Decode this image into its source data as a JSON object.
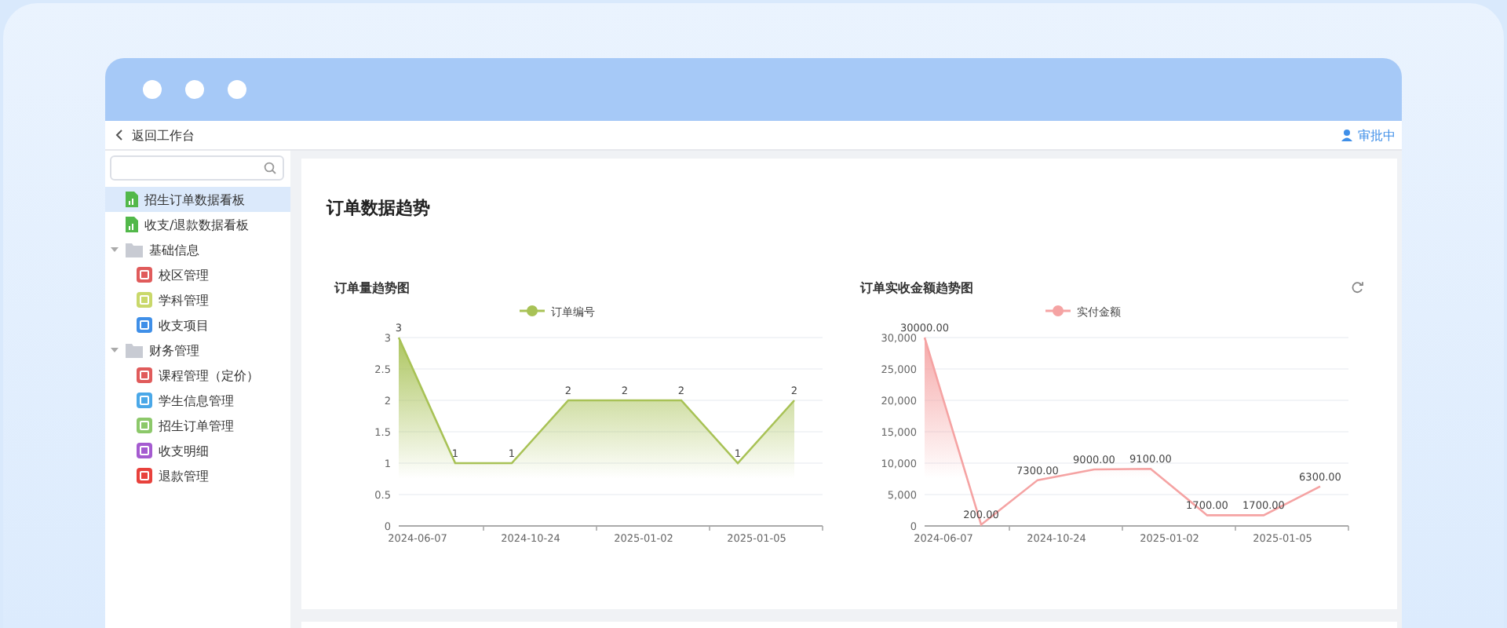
{
  "topbar": {
    "back_link": "返回工作台",
    "user_link": "审批中"
  },
  "sidebar": {
    "items": [
      {
        "kind": "page",
        "label": "招生订单数据看板",
        "selected": true
      },
      {
        "kind": "page",
        "label": "收支/退款数据看板",
        "selected": false
      },
      {
        "kind": "folder",
        "label": "基础信息",
        "selected": false,
        "expanded": true,
        "children": [
          {
            "label": "校区管理",
            "color": "#e05b5b",
            "selected": false
          },
          {
            "label": "学科管理",
            "color": "#c9d86a",
            "selected": false
          },
          {
            "label": "收支项目",
            "color": "#3f8fe8",
            "selected": false
          }
        ]
      },
      {
        "kind": "folder",
        "label": "财务管理",
        "selected": false,
        "expanded": true,
        "children": [
          {
            "label": "课程管理（定价）",
            "color": "#e05b5b",
            "selected": false
          },
          {
            "label": "学生信息管理",
            "color": "#4aa8e8",
            "selected": false
          },
          {
            "label": "招生订单管理",
            "color": "#8cc86a",
            "selected": false
          },
          {
            "label": "收支明细",
            "color": "#a55bd0",
            "selected": false
          },
          {
            "label": "退款管理",
            "color": "#e8413c",
            "selected": false
          }
        ]
      }
    ]
  },
  "main": {
    "title": "订单数据趋势",
    "charts": [
      {
        "refresh_button": false,
        "chart_data": {
          "type": "area",
          "grid": true,
          "title": "订单量趋势图",
          "categories": [
            "2024-06-07",
            null,
            "2024-10-24",
            null,
            "2025-01-02",
            null,
            "2025-01-05",
            null
          ],
          "ylim": [
            0,
            3
          ],
          "yticks": [
            0,
            0.5,
            1,
            1.5,
            2,
            2.5,
            3
          ],
          "series": [
            {
              "name": "订单编号",
              "color": "#a8c256",
              "values": [
                3,
                1,
                1,
                2,
                2,
                2,
                1,
                2
              ]
            }
          ],
          "value_labels": [
            "3",
            "1",
            "1",
            "2",
            "2",
            "2",
            "1",
            "2"
          ]
        }
      },
      {
        "refresh_button": true,
        "chart_data": {
          "type": "area",
          "grid": true,
          "title": "订单实收金额趋势图",
          "categories": [
            "2024-06-07",
            null,
            "2024-10-24",
            null,
            "2025-01-02",
            null,
            "2025-01-05",
            null
          ],
          "ylim": [
            0,
            30000
          ],
          "yticks": [
            {
              "value": 0,
              "label": "0"
            },
            {
              "value": 5000,
              "label": "5,000"
            },
            {
              "value": 10000,
              "label": "10,000"
            },
            {
              "value": 15000,
              "label": "15,000"
            },
            {
              "value": 20000,
              "label": "20,000"
            },
            {
              "value": 25000,
              "label": "25,000"
            },
            {
              "value": 30000,
              "label": "30,000"
            }
          ],
          "series": [
            {
              "name": "实付金额",
              "color": "#f5a3a3",
              "values": [
                30000,
                200,
                7300,
                9000,
                9100,
                1700,
                1700,
                6300
              ]
            }
          ],
          "value_labels": [
            "30000.00",
            "200.00",
            "7300.00",
            "9000.00",
            "9100.00",
            "1700.00",
            "1700.00",
            "6300.00"
          ]
        }
      }
    ]
  }
}
